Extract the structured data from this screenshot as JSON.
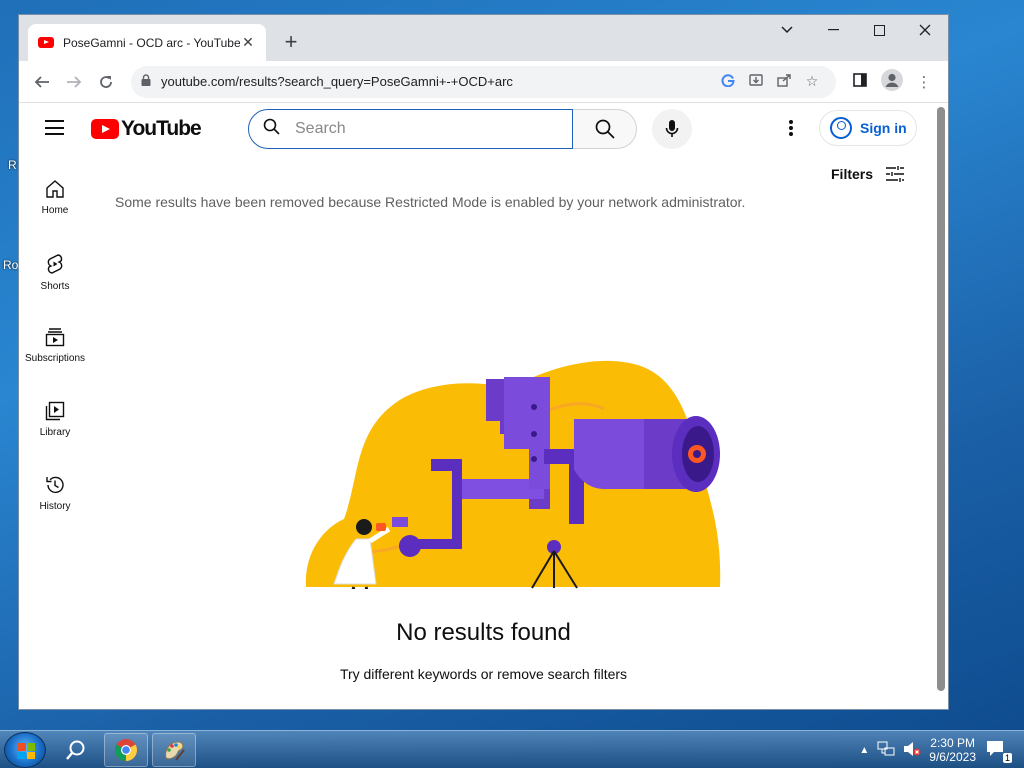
{
  "browser": {
    "tab_title": "PoseGamni - OCD arc - YouTube",
    "url": "youtube.com/results?search_query=PoseGamni+-+OCD+arc"
  },
  "youtube": {
    "logo_text": "YouTube",
    "search_placeholder": "Search",
    "signin_label": "Sign in",
    "filters_label": "Filters",
    "guide": [
      {
        "label": "Home",
        "icon": "home-icon"
      },
      {
        "label": "Shorts",
        "icon": "shorts-icon"
      },
      {
        "label": "Subscriptions",
        "icon": "subscriptions-icon"
      },
      {
        "label": "Library",
        "icon": "library-icon"
      },
      {
        "label": "History",
        "icon": "history-icon"
      }
    ],
    "restricted_notice": "Some results have been removed because Restricted Mode is enabled by your network administrator.",
    "no_results_title": "No results found",
    "no_results_sub": "Try different keywords or remove search filters"
  },
  "taskbar": {
    "time": "2:30 PM",
    "date": "9/6/2023",
    "notification_count": "1"
  },
  "colors": {
    "youtube_red": "#ff0000",
    "link_blue": "#065fd4",
    "illus_yellow": "#fbbc05",
    "illus_purple": "#6c3cc9"
  }
}
